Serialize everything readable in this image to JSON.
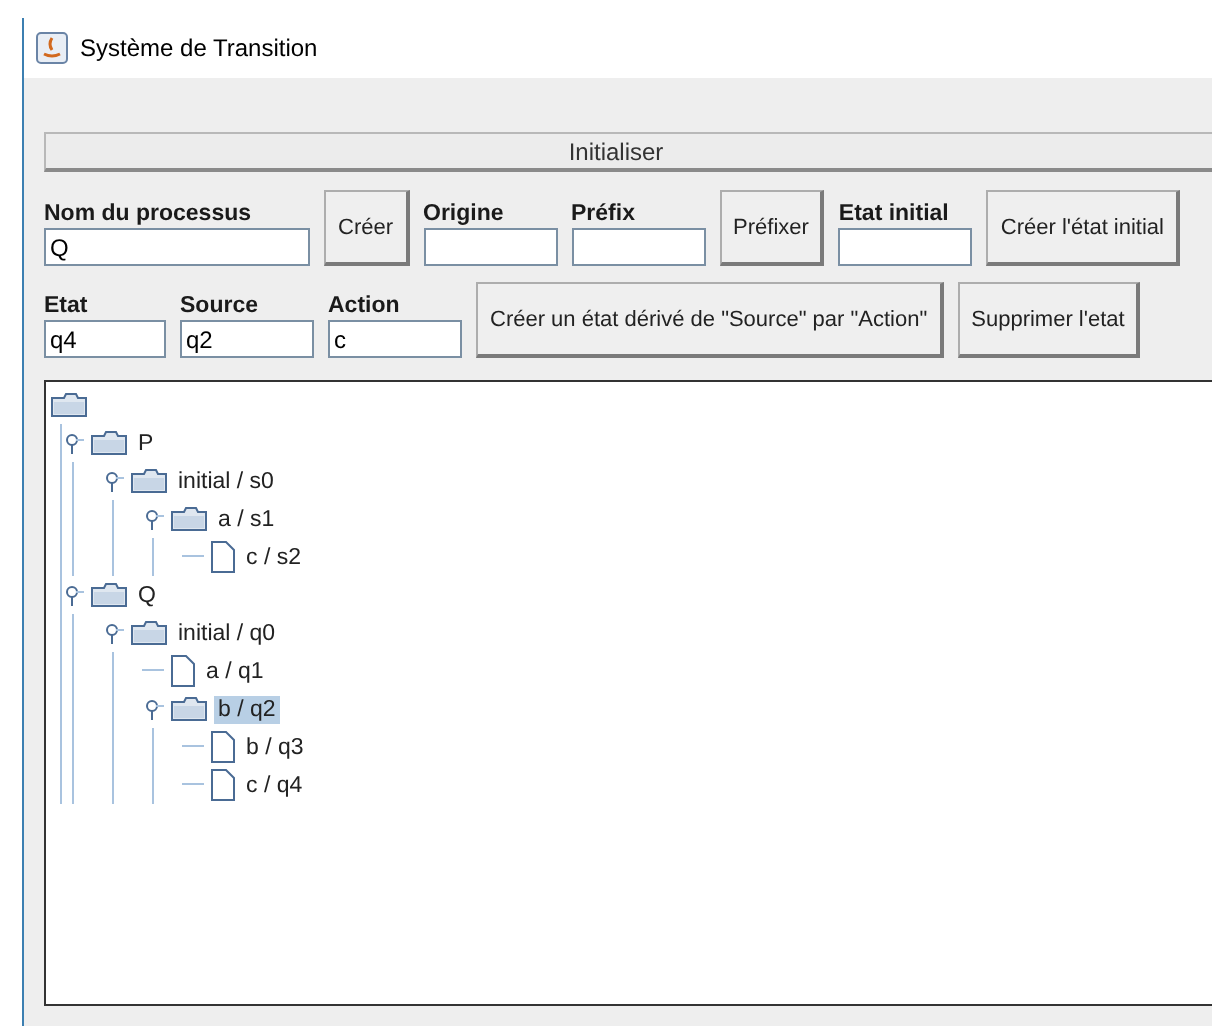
{
  "window": {
    "title": "Système de Transition"
  },
  "init_button": "Initialiser",
  "row1": [
    {
      "kind": "field",
      "label": "Nom du processus",
      "value": "Q"
    },
    {
      "kind": "button",
      "label": "Créer"
    },
    {
      "kind": "field",
      "label": "Origine"
    },
    {
      "kind": "field",
      "label": "Préfix"
    },
    {
      "kind": "button",
      "label": "Préfixer"
    },
    {
      "kind": "field",
      "label": "Etat initial"
    },
    {
      "kind": "button",
      "label": "Créer l'état initial"
    }
  ],
  "row2": [
    {
      "kind": "field",
      "label": "Etat",
      "value": "q4"
    },
    {
      "kind": "field",
      "label": "Source",
      "value": "q2"
    },
    {
      "kind": "field",
      "label": "Action",
      "value": "c"
    },
    {
      "kind": "button",
      "label": "Créer un état dérivé de \"Source\" par \"Action\""
    },
    {
      "kind": "button",
      "label": "Supprimer l'etat"
    }
  ],
  "tree": {
    "children": [
      {
        "label": "P",
        "expanded": true,
        "selected": false,
        "children": [
          {
            "label": "initial / s0",
            "expanded": true,
            "selected": false,
            "children": [
              {
                "label": "a / s1",
                "expanded": true,
                "selected": false,
                "children": [
                  {
                    "label": "c / s2",
                    "selected": false
                  }
                ]
              }
            ]
          }
        ]
      },
      {
        "label": "Q",
        "expanded": true,
        "selected": false,
        "children": [
          {
            "label": "initial / q0",
            "expanded": true,
            "selected": false,
            "children": [
              {
                "label": "a / q1",
                "selected": false
              },
              {
                "label": "b / q2",
                "expanded": true,
                "selected": true,
                "children": [
                  {
                    "label": "b / q3",
                    "selected": false
                  },
                  {
                    "label": "c / q4",
                    "selected": false
                  }
                ]
              }
            ]
          }
        ]
      }
    ]
  }
}
